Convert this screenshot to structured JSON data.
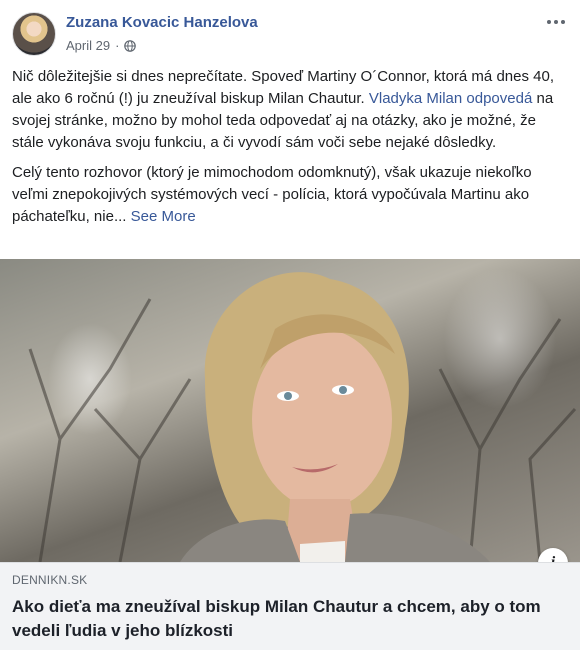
{
  "post": {
    "author": "Zuzana Kovacic Hanzelova",
    "date": "April 29",
    "separator": "·",
    "privacy_icon": "globe-icon",
    "paragraph1_part1": "Nič dôležitejšie si dnes neprečítate. Spoveď Martiny O´Connor, ktorá má dnes 40, ale ako 6 ročnú (!) ju zneužíval biskup Milan Chautur. ",
    "paragraph1_link": "Vladyka Milan odpovedá",
    "paragraph1_part2": " na svojej stránke, možno by mohol teda odpovedať aj na otázky, ako je možné, že stále vykonáva svoju funkciu, a či vyvodí sám voči sebe nejaké dôsledky.",
    "paragraph2": "Celý tento rozhovor (ktorý je mimochodom odomknutý), však ukazuje niekoľko veľmi znepokojivých systémových vecí - polícia, ktorá vypočúvala Martinu ako páchateľku, nie...",
    "see_more": "See More"
  },
  "link_preview": {
    "domain": "DENNIKN.SK",
    "title": "Ako dieťa ma zneužíval biskup Milan Chautur a chcem, aby o tom vedeli ľudia v jeho blízkosti",
    "info_icon": "info-icon"
  },
  "colors": {
    "link": "#385898",
    "text": "#1c1e21",
    "meta": "#606770",
    "card_bg": "#f2f3f5"
  }
}
